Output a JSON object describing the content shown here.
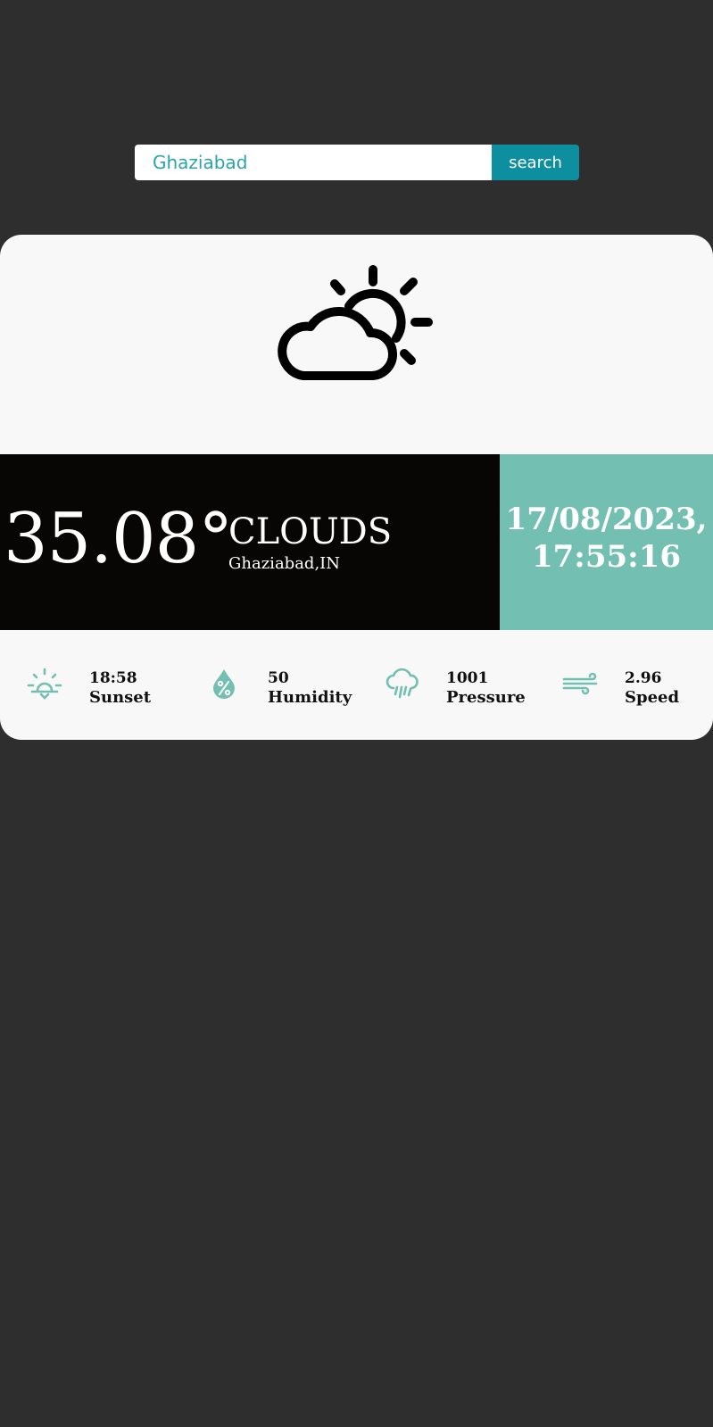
{
  "search": {
    "value": "Ghaziabad",
    "button_label": "search"
  },
  "weather": {
    "icon": "cloud-sun-icon",
    "temperature": "35.08°",
    "condition": "CLOUDS",
    "location": "Ghaziabad,IN",
    "date": "17/08/2023,",
    "time": "17:55:16"
  },
  "stats": [
    {
      "icon": "sunset-icon",
      "value": "18:58",
      "label": "Sunset"
    },
    {
      "icon": "humidity-icon",
      "value": "50",
      "label": "Humidity"
    },
    {
      "icon": "rain-cloud-icon",
      "value": "1001",
      "label": "Pressure"
    },
    {
      "icon": "wind-icon",
      "value": "2.96",
      "label": "Speed"
    }
  ],
  "colors": {
    "background": "#2e2e2e",
    "card": "#f8f8f8",
    "band_dark": "#070605",
    "accent_teal": "#73bfb1",
    "search_button": "#0e8fa0",
    "search_text": "#2ba3ab"
  }
}
